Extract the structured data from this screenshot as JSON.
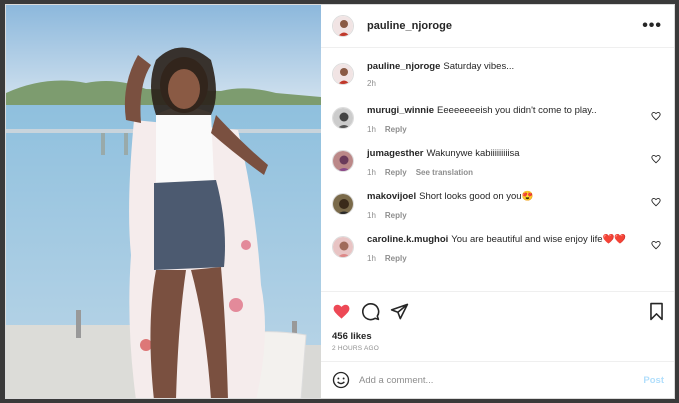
{
  "header": {
    "username": "pauline_njoroge",
    "more_label": "•••"
  },
  "caption": {
    "username": "pauline_njoroge",
    "text": "Saturday vibes...",
    "time": "2h"
  },
  "comments": [
    {
      "username": "murugi_winnie",
      "text": "Eeeeeeeeish you didn't come to play..",
      "time": "1h",
      "reply": "Reply",
      "extra": ""
    },
    {
      "username": "jumagesther",
      "text": "Wakunywe kabiiiiiiiiisa",
      "time": "1h",
      "reply": "Reply",
      "extra": "See translation"
    },
    {
      "username": "makovijoel",
      "text": "Short looks good on you😍",
      "time": "1h",
      "reply": "Reply",
      "extra": ""
    },
    {
      "username": "caroline.k.mughoi",
      "text": "You are beautiful and wise enjoy life❤️❤️",
      "time": "1h",
      "reply": "Reply",
      "extra": ""
    }
  ],
  "likes": "456 likes",
  "posted_ago": "2 HOURS AGO",
  "add_comment": {
    "placeholder": "Add a comment...",
    "post_label": "Post"
  },
  "colors": {
    "like_red": "#ed4956",
    "text": "#262626",
    "muted": "#8e8e8e",
    "post_blue": "#b2dffc"
  },
  "icons": {
    "more": "more-horizontal-icon",
    "like": "heart-filled-icon",
    "comment": "comment-icon",
    "share": "paper-plane-icon",
    "save": "bookmark-icon",
    "emoji": "smiley-icon",
    "comment_like": "heart-outline-icon"
  }
}
